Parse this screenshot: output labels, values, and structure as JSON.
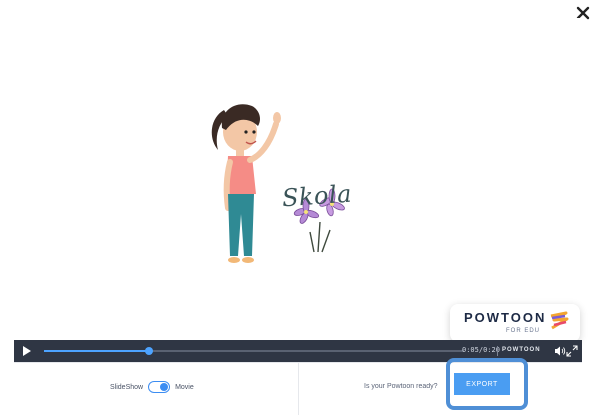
{
  "player": {
    "slide_title": "Skola",
    "logo_word": "POWTOON",
    "logo_sub": "FOR EDU",
    "time": "0:05/0:20",
    "mini_logo": "POWTOON",
    "progress_fraction": 0.25
  },
  "footer": {
    "mode_left": "SlideShow",
    "mode_right": "Movie",
    "ready_text": "Is your Powtoon ready?",
    "export_label": "EXPORT"
  },
  "colors": {
    "accent": "#4a9df2",
    "controls_bg": "#2f3644",
    "highlight_outline": "#4f8fd6"
  },
  "icons": [
    "close-icon",
    "play-icon",
    "volume-icon",
    "fullscreen-icon",
    "powtoon-logo-mark"
  ]
}
